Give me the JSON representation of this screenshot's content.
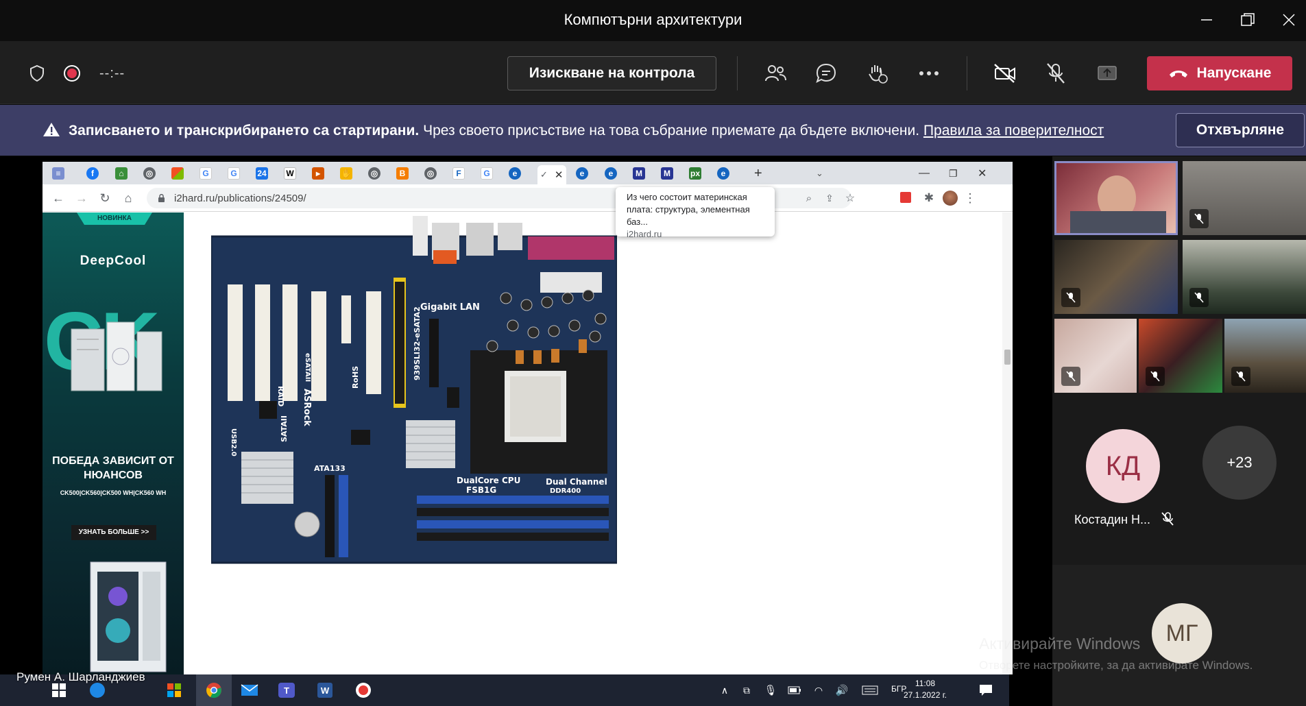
{
  "window": {
    "title": "Компютърни архитектури"
  },
  "toolbar": {
    "timer": "--:--",
    "request_control_label": "Изискване на контрола",
    "leave_label": "Напускане",
    "leave_color": "#c4314b"
  },
  "notice": {
    "bold_text": "Записването и транскрибирането са стартирани.",
    "text": "Чрез своето присъствие на това събрание приемате да бъдете включени.",
    "link_text": "Правила за поверителност",
    "dismiss_label": "Отхвърляне",
    "background": "#3d3e66"
  },
  "browser": {
    "url": "i2hard.ru/publications/24509/",
    "tooltip": {
      "title": "Из чего состоит материнская плата: структура, элементная баз...",
      "domain": "i2hard.ru"
    }
  },
  "ad": {
    "badge": "НОВИНКА",
    "brand": "DeepCool",
    "big_text": "CK",
    "headline": "ПОБЕДА ЗАВИСИТ ОТ НЮАНСОВ",
    "models": "CK500|CK560|CK500 WH|CK560 WH",
    "cta": "УЗНАТЬ БОЛЬШЕ >>"
  },
  "motherboard": {
    "labels": [
      "Gigabit LAN",
      "DualCore CPU",
      "FSB1G",
      "Dual Channel",
      "DDR400",
      "ATA133",
      "SATAII",
      "RAID",
      "USB2.0",
      "eSATAII",
      "RoHS",
      "ASRock",
      "939SLI32-eSATA2"
    ]
  },
  "taskbar": {
    "presenter": "Румен А. Шарланджиев",
    "language": "БГР",
    "time": "11:08",
    "date": "27.1.2022 г."
  },
  "gallery": {
    "avatar1_initials": "КД",
    "avatar1_name": "Костадин Н...",
    "avatar1_color": "#f4d5da",
    "more_count": "+23",
    "avatar2_initials": "МГ"
  },
  "watermark": {
    "line1": "Активирайте Windows",
    "line2": "Отворете настройките, за да активирате Windows."
  }
}
